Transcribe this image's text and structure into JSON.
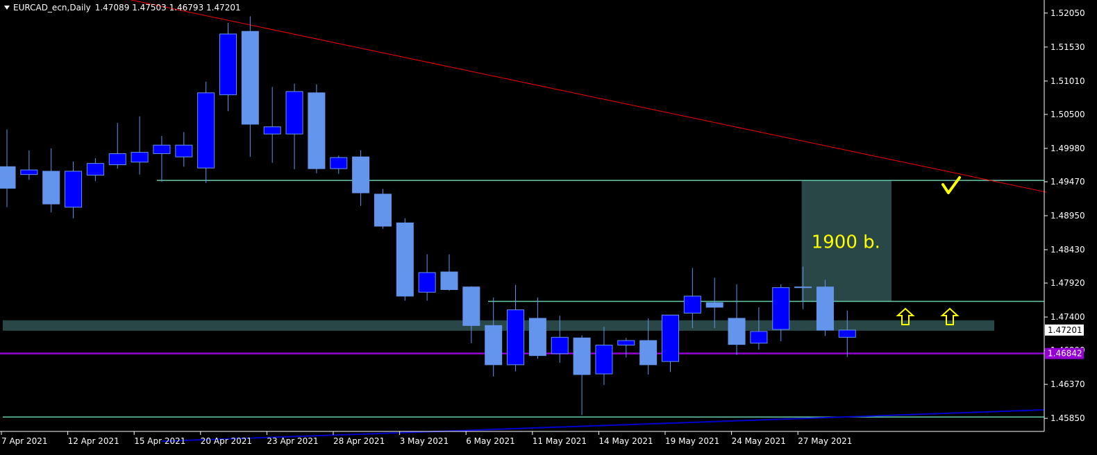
{
  "header": {
    "symbol_timeframe": "EURCAD_ecn,Daily",
    "ohlc": "1.47089 1.47503 1.46793 1.47201"
  },
  "colors": {
    "background": "#000000",
    "bull_fill": "#0000ff",
    "bear_fill": "#6495ed",
    "wick": "#6495ed",
    "trendline": "#ff0000",
    "support_line": "#66cdaa",
    "zone": "#2f4f4f",
    "purple_line": "#9400d3",
    "moving_average": "#0000cd",
    "annotation": "#ffff00",
    "axis_text": "#ffffff"
  },
  "annotations": {
    "box_label": "1900 b.",
    "check_icon": "checkmark-icon",
    "arrow_icon": "arrow-up-outline-icon"
  },
  "price_labels": {
    "current": "1.47201",
    "purple": "1.46842"
  },
  "chart_data": {
    "type": "candlestick",
    "title": "EURCAD_ecn,Daily",
    "ylim": [
      1.4565,
      1.5225
    ],
    "y_ticks": [
      "1.52050",
      "1.51530",
      "1.51010",
      "1.50500",
      "1.49980",
      "1.49470",
      "1.48950",
      "1.48430",
      "1.47920",
      "1.47400",
      "1.46890",
      "1.46370",
      "1.45850"
    ],
    "x_ticks": [
      "7 Apr 2021",
      "12 Apr 2021",
      "15 Apr 2021",
      "20 Apr 2021",
      "23 Apr 2021",
      "28 Apr 2021",
      "3 May 2021",
      "6 May 2021",
      "11 May 2021",
      "14 May 2021",
      "19 May 2021",
      "24 May 2021",
      "27 May 2021"
    ],
    "candles": [
      {
        "o": 1.497,
        "h": 1.5027,
        "l": 1.4908,
        "c": 1.4937
      },
      {
        "o": 1.4958,
        "h": 1.4995,
        "l": 1.495,
        "c": 1.4965
      },
      {
        "o": 1.4963,
        "h": 1.4998,
        "l": 1.49,
        "c": 1.4913
      },
      {
        "o": 1.4908,
        "h": 1.4978,
        "l": 1.4891,
        "c": 1.4963
      },
      {
        "o": 1.4957,
        "h": 1.4983,
        "l": 1.4948,
        "c": 1.4975
      },
      {
        "o": 1.4973,
        "h": 1.5037,
        "l": 1.4967,
        "c": 1.499
      },
      {
        "o": 1.4977,
        "h": 1.5047,
        "l": 1.4958,
        "c": 1.4992
      },
      {
        "o": 1.499,
        "h": 1.5017,
        "l": 1.4947,
        "c": 1.5003
      },
      {
        "o": 1.4985,
        "h": 1.5023,
        "l": 1.497,
        "c": 1.5003
      },
      {
        "o": 1.4968,
        "h": 1.51,
        "l": 1.4945,
        "c": 1.5083
      },
      {
        "o": 1.508,
        "h": 1.519,
        "l": 1.5055,
        "c": 1.5173
      },
      {
        "o": 1.5177,
        "h": 1.52,
        "l": 1.4985,
        "c": 1.5035
      },
      {
        "o": 1.502,
        "h": 1.5092,
        "l": 1.4976,
        "c": 1.5031
      },
      {
        "o": 1.502,
        "h": 1.5097,
        "l": 1.4966,
        "c": 1.5085
      },
      {
        "o": 1.5083,
        "h": 1.5096,
        "l": 1.496,
        "c": 1.4967
      },
      {
        "o": 1.4967,
        "h": 1.4987,
        "l": 1.4959,
        "c": 1.4984
      },
      {
        "o": 1.4985,
        "h": 1.4995,
        "l": 1.491,
        "c": 1.493
      },
      {
        "o": 1.4928,
        "h": 1.4936,
        "l": 1.4875,
        "c": 1.4879
      },
      {
        "o": 1.4884,
        "h": 1.4891,
        "l": 1.4765,
        "c": 1.4772
      },
      {
        "o": 1.4778,
        "h": 1.4836,
        "l": 1.4765,
        "c": 1.4808
      },
      {
        "o": 1.4809,
        "h": 1.4836,
        "l": 1.478,
        "c": 1.4782
      },
      {
        "o": 1.4786,
        "h": 1.4787,
        "l": 1.47,
        "c": 1.4727
      },
      {
        "o": 1.4727,
        "h": 1.477,
        "l": 1.4649,
        "c": 1.4667
      },
      {
        "o": 1.4667,
        "h": 1.4789,
        "l": 1.4657,
        "c": 1.4751
      },
      {
        "o": 1.4738,
        "h": 1.477,
        "l": 1.4676,
        "c": 1.4681
      },
      {
        "o": 1.4684,
        "h": 1.4742,
        "l": 1.467,
        "c": 1.4709
      },
      {
        "o": 1.4708,
        "h": 1.4712,
        "l": 1.459,
        "c": 1.4652
      },
      {
        "o": 1.4653,
        "h": 1.4725,
        "l": 1.4636,
        "c": 1.4697
      },
      {
        "o": 1.4697,
        "h": 1.4708,
        "l": 1.4678,
        "c": 1.4704
      },
      {
        "o": 1.4704,
        "h": 1.4738,
        "l": 1.4652,
        "c": 1.4667
      },
      {
        "o": 1.4672,
        "h": 1.474,
        "l": 1.4656,
        "c": 1.4743
      },
      {
        "o": 1.4746,
        "h": 1.4815,
        "l": 1.4723,
        "c": 1.4772
      },
      {
        "o": 1.4762,
        "h": 1.48,
        "l": 1.4723,
        "c": 1.4755
      },
      {
        "o": 1.4738,
        "h": 1.479,
        "l": 1.4682,
        "c": 1.4698
      },
      {
        "o": 1.47,
        "h": 1.4755,
        "l": 1.469,
        "c": 1.4718
      },
      {
        "o": 1.4721,
        "h": 1.479,
        "l": 1.4703,
        "c": 1.4785
      },
      {
        "o": 1.4786,
        "h": 1.4817,
        "l": 1.4752,
        "c": 1.4786
      },
      {
        "o": 1.4786,
        "h": 1.4797,
        "l": 1.4711,
        "c": 1.472
      },
      {
        "o": 1.4709,
        "h": 1.475,
        "l": 1.4679,
        "c": 1.472
      }
    ],
    "levels": {
      "upper_support": 1.4949,
      "mid_support": 1.4764,
      "zone_top": 1.4735,
      "zone_bottom": 1.4719,
      "purple": 1.46842,
      "lower_support": 1.4587
    },
    "trendline": {
      "start": [
        0,
        1.5265
      ],
      "end": [
        47,
        1.4931
      ]
    },
    "box": {
      "start_index": 36,
      "end_index": 40,
      "top": 1.4949,
      "bottom": 1.4764
    },
    "moving_average": {
      "start": [
        7,
        1.455
      ],
      "end": [
        47,
        1.4598
      ]
    }
  }
}
